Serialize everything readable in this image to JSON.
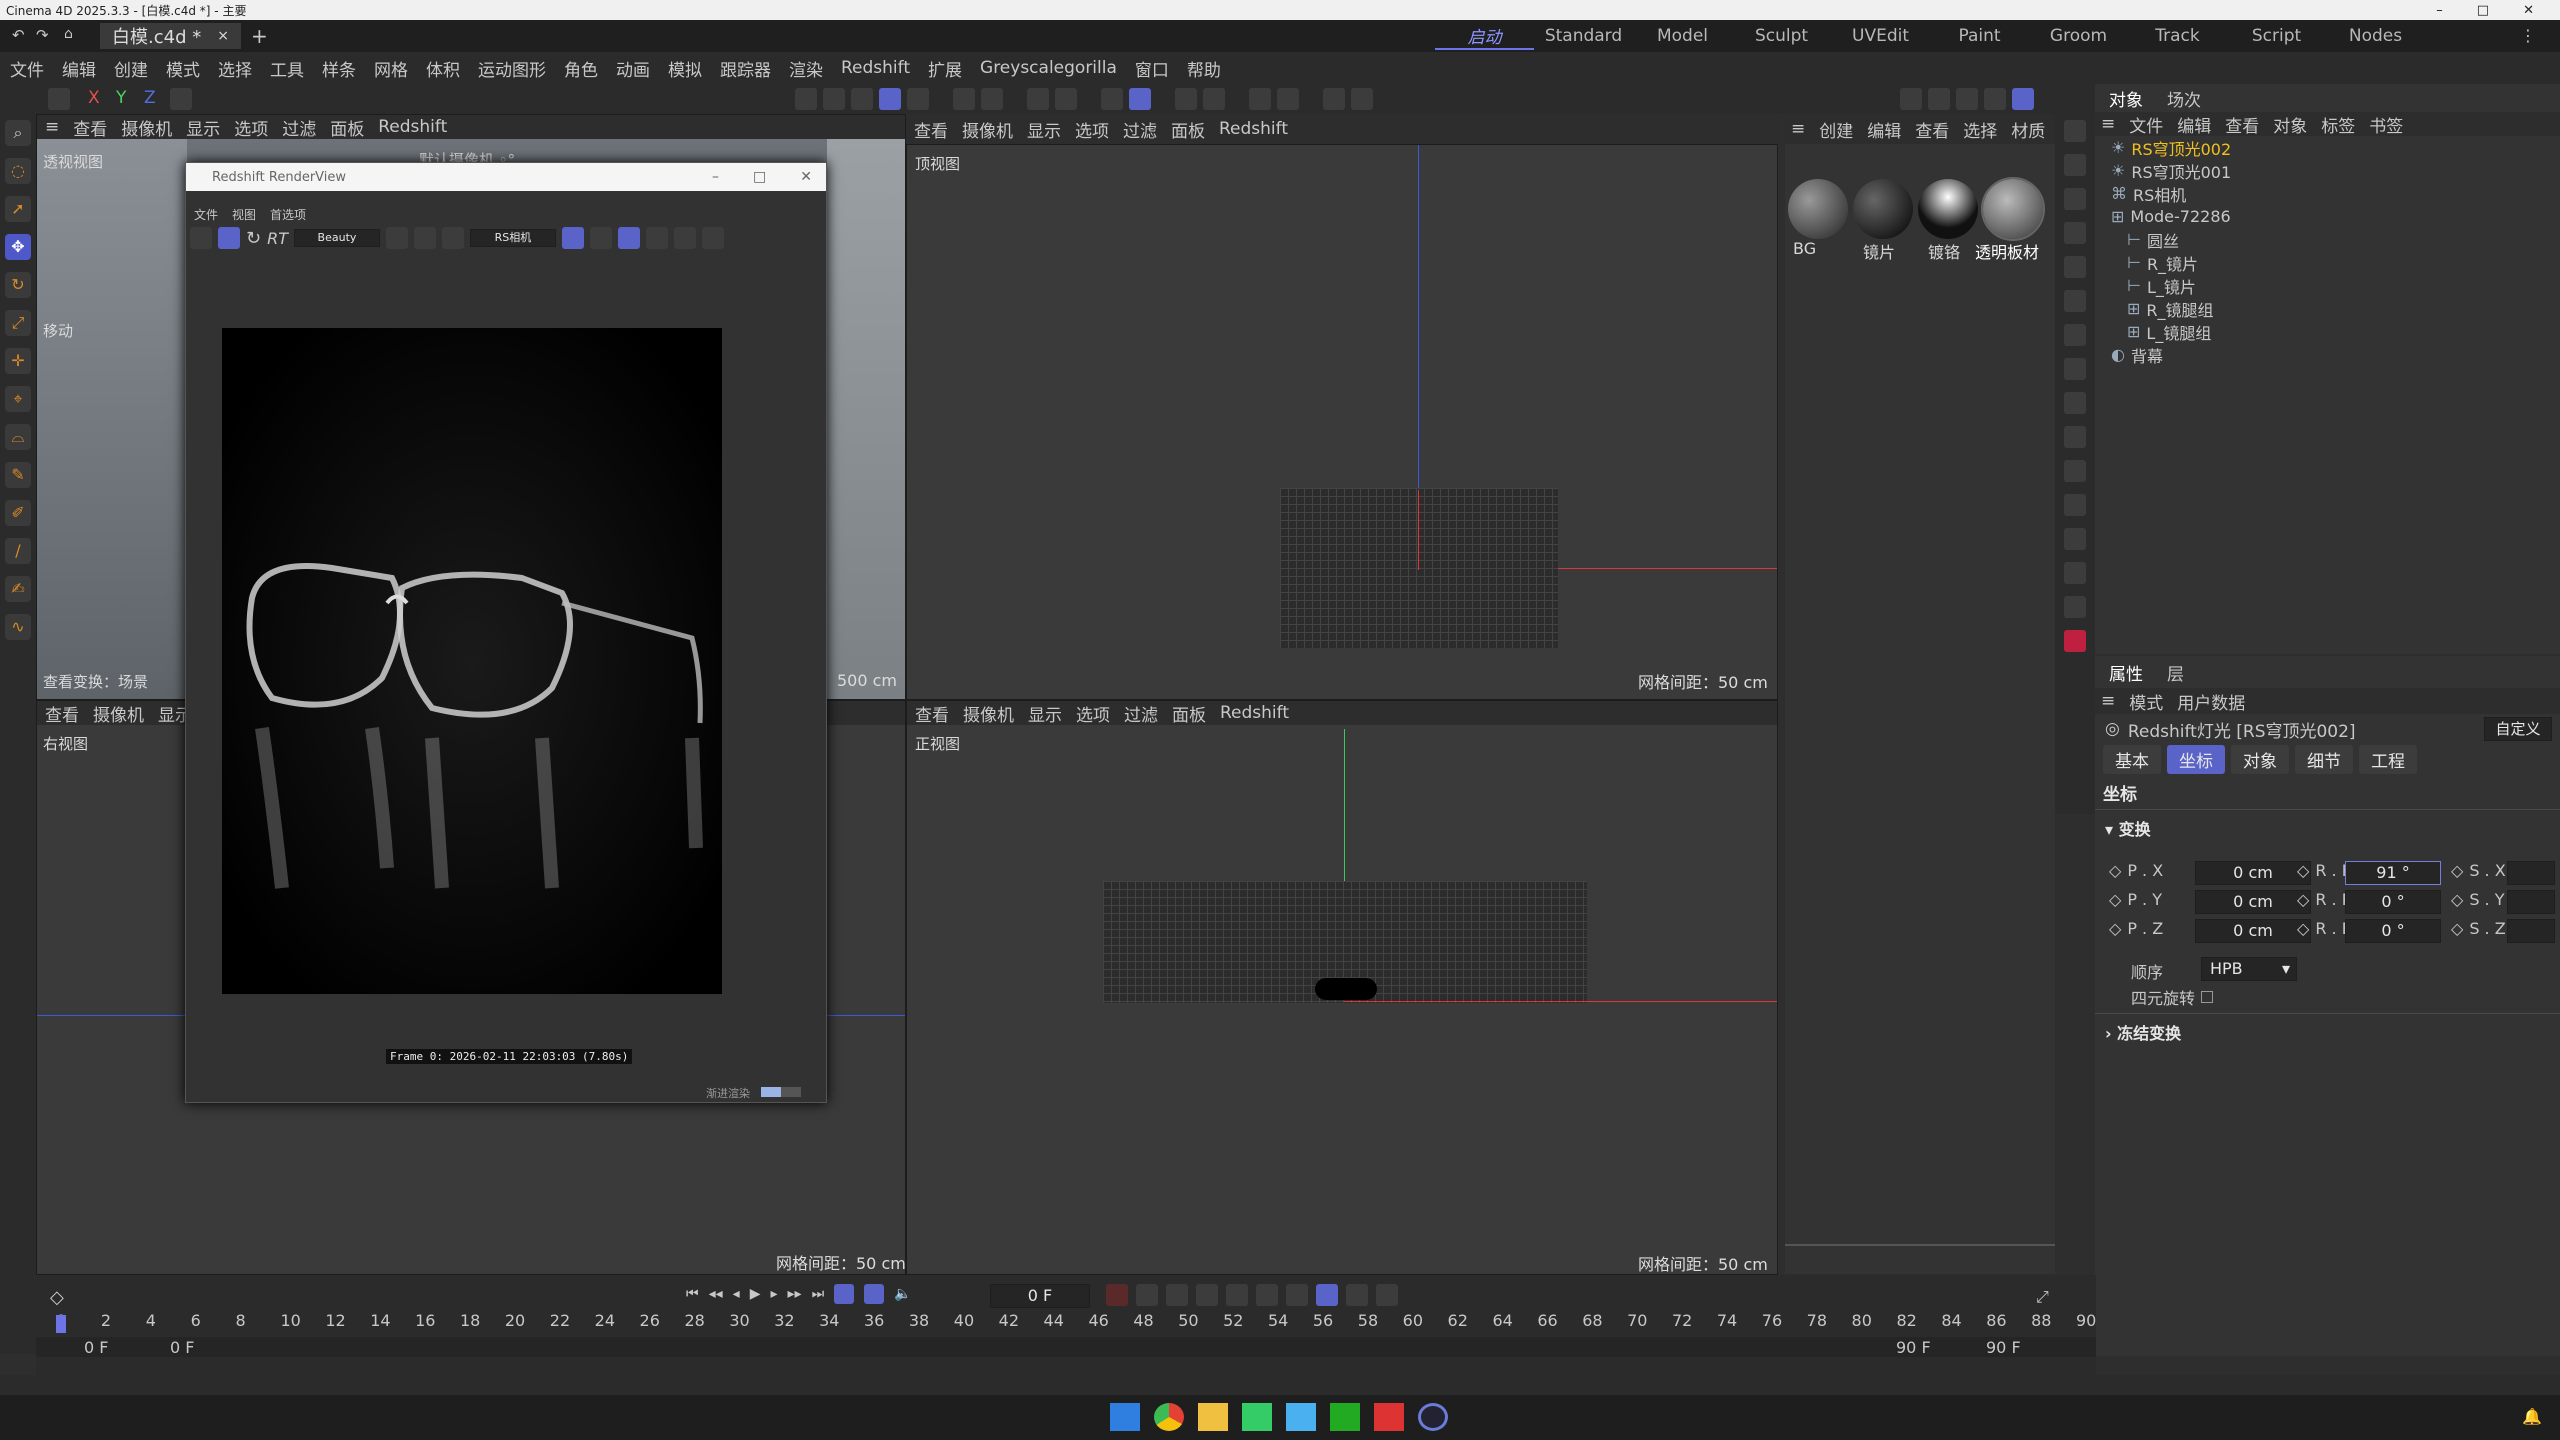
{
  "os_title": "Cinema 4D 2025.3.3 - [白模.c4d *] - 主要",
  "tab": {
    "doc": "白模.c4d *",
    "close": "×",
    "add": "+"
  },
  "layouts": [
    "启动",
    "Standard",
    "Model",
    "Sculpt",
    "UVEdit",
    "Paint",
    "Groom",
    "Track",
    "Script",
    "Nodes"
  ],
  "menu": [
    "文件",
    "编辑",
    "创建",
    "模式",
    "选择",
    "工具",
    "样条",
    "网格",
    "体积",
    "运动图形",
    "角色",
    "动画",
    "模拟",
    "跟踪器",
    "渲染",
    "Redshift",
    "扩展",
    "Greyscalegorilla",
    "窗口",
    "帮助"
  ],
  "axes": [
    "X",
    "Y",
    "Z"
  ],
  "viewports": {
    "menu": [
      "查看",
      "摄像机",
      "显示",
      "选项",
      "过滤",
      "面板",
      "Redshift"
    ],
    "persp": {
      "label": "透视视图",
      "sub": "默认摄像机 ◦°",
      "move": "移动",
      "status": "查看变换：场景",
      "grid": "500 cm"
    },
    "top": {
      "label": "顶视图",
      "grid": "网格间距：50 cm"
    },
    "right": {
      "label": "右视图"
    },
    "front": {
      "label": "正视图",
      "grid": "网格间距：50 cm"
    },
    "bottom_grid": "网格间距：50 cm"
  },
  "render_window": {
    "title": "Redshift RenderView",
    "menu": [
      "文件",
      "视图",
      "首选项"
    ],
    "rt": "RT",
    "aov": "Beauty",
    "camera": "RS相机",
    "frame_info": "Frame  0:  2026-02-11  22:03:03  (7.80s)",
    "progress_label": "渐进渲染"
  },
  "materials": {
    "menu": [
      "创建",
      "编辑",
      "查看",
      "选择",
      "材质"
    ],
    "items": [
      "BG",
      "镜片",
      "镀铬",
      "透明板材"
    ]
  },
  "object_manager": {
    "tabs": [
      "对象",
      "场次"
    ],
    "menu": [
      "文件",
      "编辑",
      "查看",
      "对象",
      "标签",
      "书签"
    ],
    "rows": [
      {
        "name": "RS穹顶光002",
        "active": true
      },
      {
        "name": "RS穹顶光001"
      },
      {
        "name": "RS相机"
      },
      {
        "name": "Mode-72286"
      },
      {
        "name": "圆丝"
      },
      {
        "name": "R_镜片"
      },
      {
        "name": "L_镜片"
      },
      {
        "name": "R_镜腿组"
      },
      {
        "name": "L_镜腿组"
      },
      {
        "name": "背幕"
      }
    ]
  },
  "attributes": {
    "tabs": [
      "属性",
      "层"
    ],
    "menu": [
      "模式",
      "用户数据"
    ],
    "object": "Redshift灯光 [RS穹顶光002]",
    "preset": "自定义",
    "subtabs": [
      "基本",
      "坐标",
      "对象",
      "细节",
      "工程"
    ],
    "active_subtab": "坐标",
    "section": "坐标",
    "group": "变换",
    "px_label": "P . X",
    "px": "0 cm",
    "py_label": "P . Y",
    "py": "0 cm",
    "pz_label": "P . Z",
    "pz": "0 cm",
    "rh_label": "R . H",
    "rh": "91 °",
    "rp_label": "R . P",
    "rp": "0 °",
    "rb_label": "R . B",
    "rb": "0 °",
    "sx_label": "S . X",
    "sy_label": "S . Y",
    "sz_label": "S . Z",
    "order_label": "顺序",
    "order": "HPB",
    "quat_label": "四元旋转",
    "freeze": "冻结变换"
  },
  "timeline": {
    "current": "0 F",
    "ticks": [
      "0",
      "2",
      "4",
      "6",
      "8",
      "10",
      "12",
      "14",
      "16",
      "18",
      "20",
      "22",
      "24",
      "26",
      "28",
      "30",
      "32",
      "34",
      "36",
      "38",
      "40",
      "42",
      "44",
      "46",
      "48",
      "50",
      "52",
      "54",
      "56",
      "58",
      "60",
      "62",
      "64",
      "66",
      "68",
      "70",
      "72",
      "74",
      "76",
      "78",
      "80",
      "82",
      "84",
      "86",
      "88",
      "90"
    ],
    "start": "0 F",
    "start2": "0 F",
    "end": "90 F",
    "end2": "90 F"
  },
  "colors": {
    "accent": "#5a63c8",
    "x_axis": "#d83a3a",
    "y_axis": "#3cc85a",
    "z_axis": "#3a5ad8",
    "active_object": "#f0c020"
  }
}
